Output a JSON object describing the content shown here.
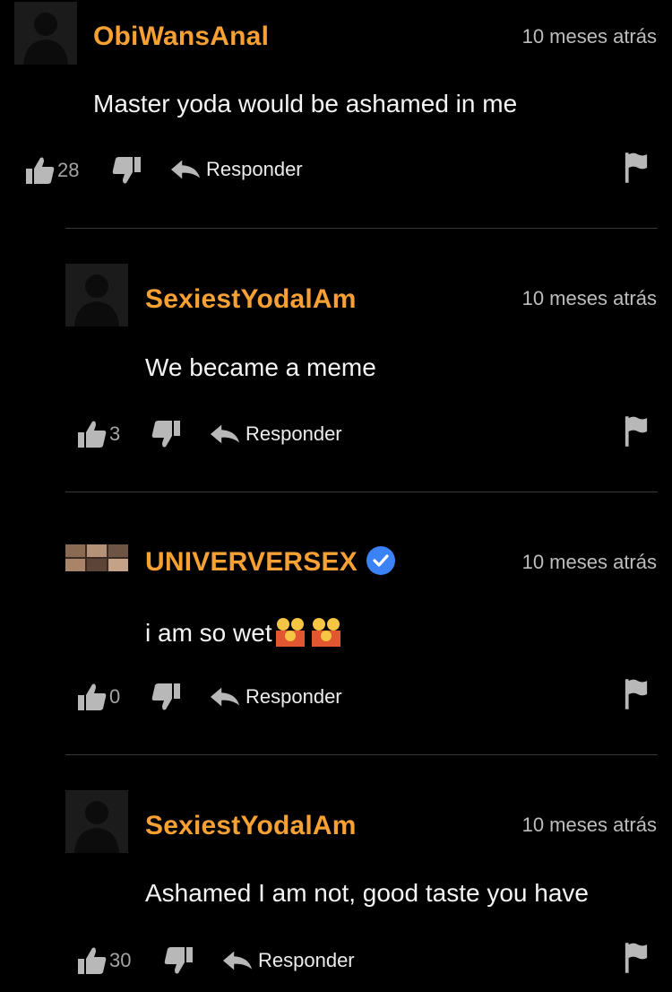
{
  "reply_label": "Responder",
  "comments": [
    {
      "username": "ObiWansAnal",
      "time": "10 meses atrás",
      "text": "Master yoda would be ashamed in me",
      "likes": "28"
    },
    {
      "username": "SexiestYodalAm",
      "time": "10 meses atrás",
      "text": "We became a meme",
      "likes": "3"
    },
    {
      "username": "UNIVERVERSEX",
      "time": "10 meses atrás",
      "text": "i am so wet",
      "likes": "0",
      "verified": true
    },
    {
      "username": "SexiestYodalAm",
      "time": "10 meses atrás",
      "text": "Ashamed I am not, good taste you have",
      "likes": "30"
    }
  ],
  "colors": {
    "username": "#f7a033",
    "verified": "#3b82f6",
    "background": "#000000"
  }
}
